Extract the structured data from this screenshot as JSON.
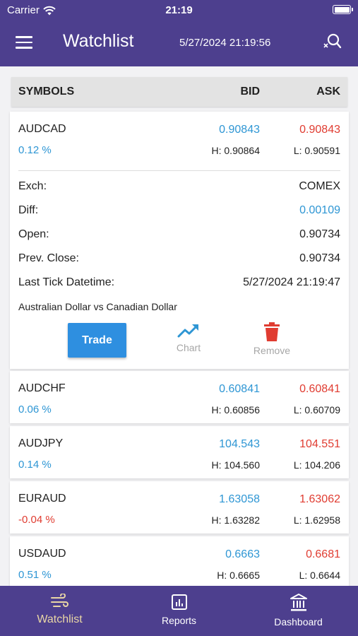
{
  "status_bar": {
    "carrier": "Carrier",
    "time": "21:19"
  },
  "header": {
    "title": "Watchlist",
    "datetime": "5/27/2024 21:19:56"
  },
  "table_header": {
    "symbols": "SYMBOLS",
    "bid": "BID",
    "ask": "ASK"
  },
  "rows": [
    {
      "symbol": "AUDCAD",
      "bid": "0.90843",
      "ask": "0.90843",
      "change": "0.12 %",
      "high": "H: 0.90864",
      "low": "L: 0.90591"
    },
    {
      "symbol": "AUDCHF",
      "bid": "0.60841",
      "ask": "0.60841",
      "change": "0.06 %",
      "high": "H: 0.60856",
      "low": "L: 0.60709"
    },
    {
      "symbol": "AUDJPY",
      "bid": "104.543",
      "ask": "104.551",
      "change": "0.14 %",
      "high": "H: 104.560",
      "low": "L: 104.206"
    },
    {
      "symbol": "EURAUD",
      "bid": "1.63058",
      "ask": "1.63062",
      "change": "-0.04 %",
      "high": "H: 1.63282",
      "low": "L: 1.62958"
    },
    {
      "symbol": "USDAUD",
      "bid": "0.6663",
      "ask": "0.6681",
      "change": "0.51 %",
      "high": "H: 0.6665",
      "low": "L: 0.6644"
    }
  ],
  "details": {
    "exch_label": "Exch:",
    "exch_value": "COMEX",
    "diff_label": "Diff:",
    "diff_value": "0.00109",
    "open_label": "Open:",
    "open_value": "0.90734",
    "prev_close_label": "Prev. Close:",
    "prev_close_value": "0.90734",
    "last_tick_label": "Last Tick Datetime:",
    "last_tick_value": "5/27/2024 21:19:47",
    "description": "Australian Dollar vs Canadian Dollar"
  },
  "actions": {
    "trade": "Trade",
    "chart": "Chart",
    "remove": "Remove"
  },
  "tabs": [
    {
      "label": "Watchlist",
      "icon": "wind-icon",
      "active": true
    },
    {
      "label": "Reports",
      "icon": "report-chart-icon",
      "active": false
    },
    {
      "label": "Dashboard",
      "icon": "bank-icon",
      "active": false
    }
  ],
  "colors": {
    "header_bg": "#4d3f8e",
    "positive": "#2e96d4",
    "negative": "#e03c31",
    "trade_button": "#2e8fe0",
    "remove_icon": "#e03c31",
    "active_tab": "#e9d6a5"
  }
}
